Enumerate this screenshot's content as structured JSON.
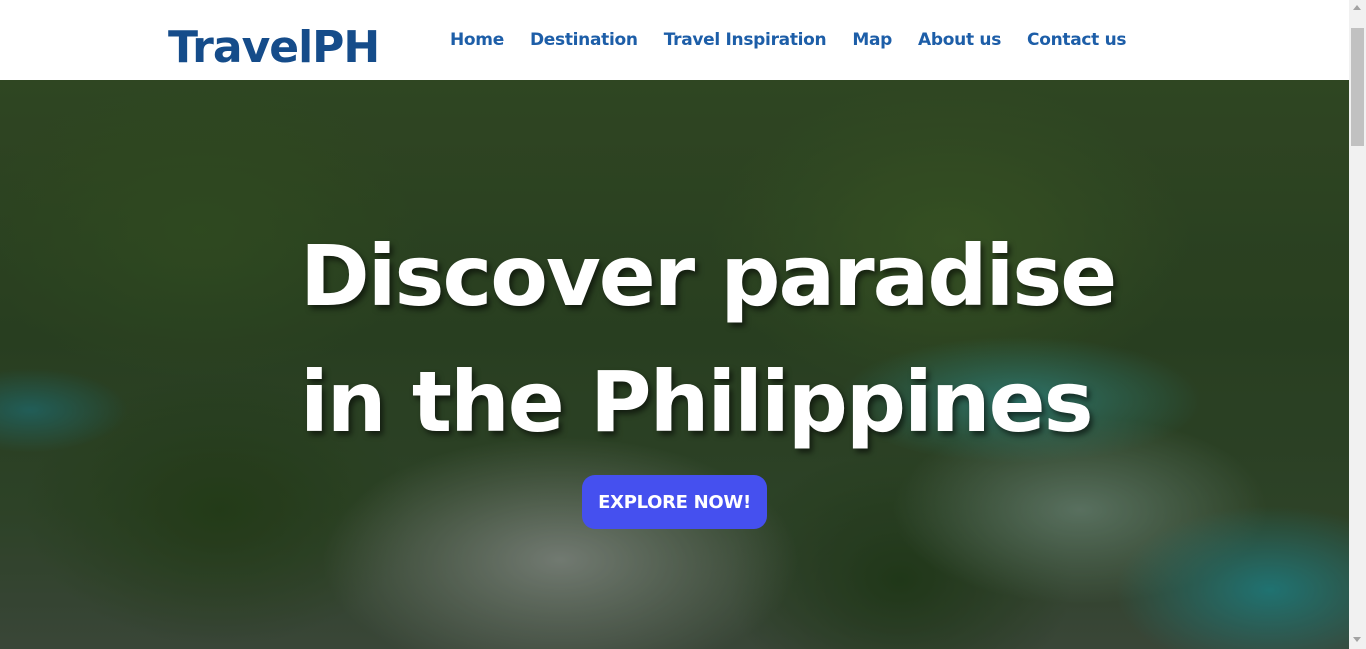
{
  "header": {
    "logo_text": "TravelPH",
    "nav": {
      "home": "Home",
      "destination": "Destination",
      "travel_inspiration": "Travel Inspiration",
      "map": "Map",
      "about_us": "About us",
      "contact_us": "Contact us"
    }
  },
  "hero": {
    "title_line1": "Discover paradise",
    "title_line2": "in the Philippines",
    "cta_label": "EXPLORE NOW!",
    "background_image": "aerial-lagoon-islands-photo"
  },
  "colors": {
    "logo": "#154c8a",
    "nav_link": "#1d5ea8",
    "cta_background": "#4550ef",
    "hero_text": "#ffffff"
  }
}
